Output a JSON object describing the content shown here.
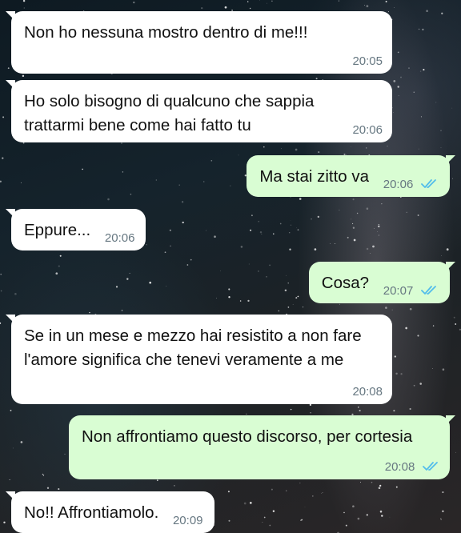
{
  "colors": {
    "incoming_bubble": "#ffffff",
    "outgoing_bubble": "#d9fdd3",
    "timestamp": "#667781",
    "read_ticks": "#53bdeb"
  },
  "messages": [
    {
      "direction": "incoming",
      "text": "Non ho nessuna mostro dentro di me!!!",
      "time": "20:05"
    },
    {
      "direction": "incoming",
      "text": "Ho solo bisogno di qualcuno che sappia trattarmi bene come hai fatto tu",
      "time": "20:06"
    },
    {
      "direction": "outgoing",
      "text": "Ma stai zitto va",
      "time": "20:06",
      "status_icon": "double-check-read-icon"
    },
    {
      "direction": "incoming",
      "text": "Eppure...",
      "time": "20:06"
    },
    {
      "direction": "outgoing",
      "text": "Cosa?",
      "time": "20:07",
      "status_icon": "double-check-read-icon"
    },
    {
      "direction": "incoming",
      "text": "Se in un mese e mezzo hai resistito a non fare l'amore significa che tenevi veramente a me",
      "time": "20:08"
    },
    {
      "direction": "outgoing",
      "text": "Non affrontiamo questo discorso, per cortesia",
      "time": "20:08",
      "status_icon": "double-check-read-icon"
    },
    {
      "direction": "incoming",
      "text": "No!! Affrontiamolo.",
      "time": "20:09"
    }
  ]
}
